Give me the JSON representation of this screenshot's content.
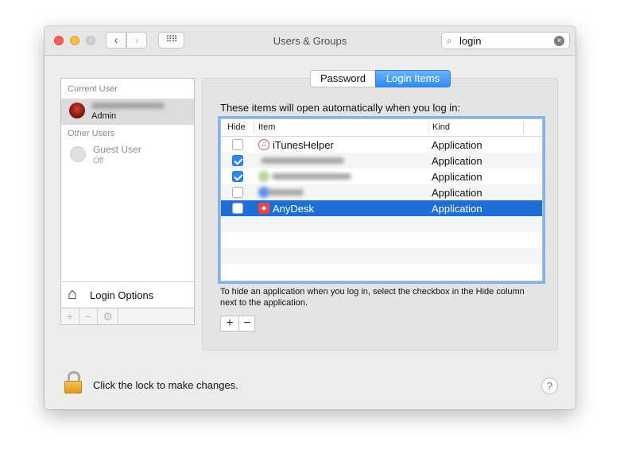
{
  "window": {
    "title": "Users & Groups"
  },
  "toolbar": {
    "back_glyph": "‹",
    "forward_glyph": "›",
    "grid_glyph": "⠿⠿"
  },
  "search": {
    "value": "login",
    "placeholder": "Search",
    "icon": "search-icon",
    "clear_glyph": "×"
  },
  "sidebar": {
    "current_user_header": "Current User",
    "current_user": {
      "role": "Admin"
    },
    "other_users_header": "Other Users",
    "guest": {
      "name": "Guest User",
      "status": "Off"
    },
    "login_options_label": "Login Options",
    "tools": {
      "add": "+",
      "remove": "−",
      "gear": "⚙"
    }
  },
  "tabs": [
    {
      "label": "Password",
      "selected": false
    },
    {
      "label": "Login Items",
      "selected": true
    }
  ],
  "main": {
    "intro": "These items will open automatically when you log in:",
    "columns": {
      "hide": "Hide",
      "item": "Item",
      "kind": "Kind"
    },
    "items": [
      {
        "name": "iTunesHelper",
        "kind": "Application",
        "hide": false,
        "icon": "itunes-icon"
      },
      {
        "name": "",
        "kind": "Application",
        "hide": true,
        "icon": "blurred-app-icon",
        "redacted": true
      },
      {
        "name": "",
        "kind": "Application",
        "hide": true,
        "icon": "blurred-app-icon",
        "redacted": true
      },
      {
        "name": "",
        "kind": "Application",
        "hide": false,
        "icon": "blurred-app-icon",
        "redacted": true
      },
      {
        "name": "AnyDesk",
        "kind": "Application",
        "hide": false,
        "icon": "anydesk-icon",
        "selected": true
      }
    ],
    "hint": "To hide an application when you log in, select the checkbox in the Hide column next to the application.",
    "add_glyph": "+",
    "remove_glyph": "−"
  },
  "footer": {
    "lock_text": "Click the lock to make changes.",
    "help_glyph": "?"
  },
  "colors": {
    "accent": "#2f8cf6",
    "selection": "#1d6fd6",
    "focus_ring": "#7fb4ef"
  }
}
